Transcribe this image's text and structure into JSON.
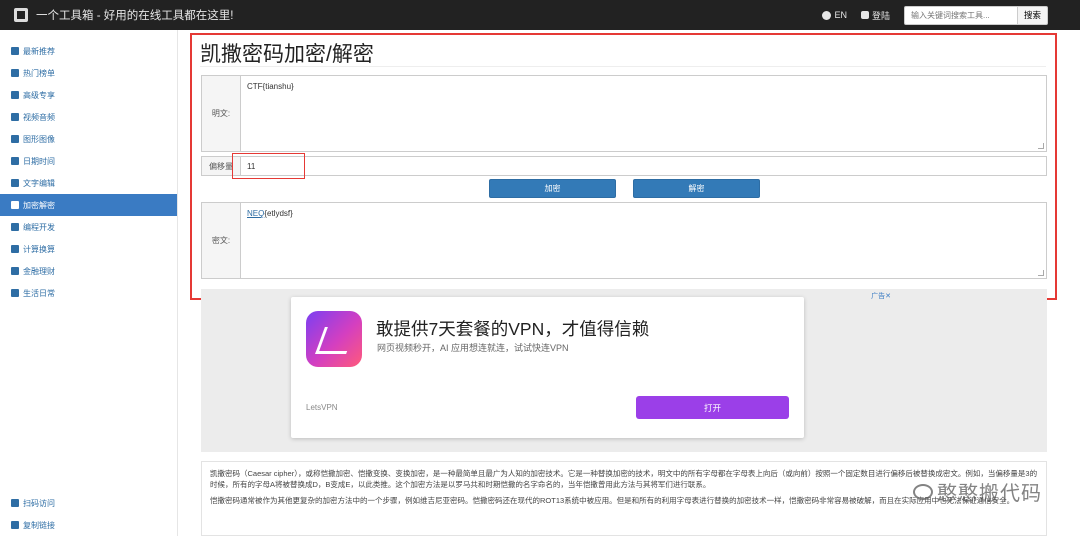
{
  "header": {
    "title": "一个工具箱 - 好用的在线工具都在这里!",
    "lang_label": "EN",
    "login_label": "登陆",
    "search_placeholder": "输入关键词搜索工具...",
    "search_button": "搜索"
  },
  "sidebar": {
    "items": [
      {
        "label": "最新推荐",
        "icon": "home-icon"
      },
      {
        "label": "热门榜单",
        "icon": "flag-icon"
      },
      {
        "label": "高级专享",
        "icon": "heart-icon"
      },
      {
        "label": "视频音频",
        "icon": "film-icon"
      },
      {
        "label": "图形图像",
        "icon": "image-icon"
      },
      {
        "label": "日期时间",
        "icon": "calendar-icon"
      },
      {
        "label": "文字编辑",
        "icon": "text-icon"
      },
      {
        "label": "加密解密",
        "icon": "lock-icon"
      },
      {
        "label": "编程开发",
        "icon": "code-icon"
      },
      {
        "label": "计算换算",
        "icon": "exchange-icon"
      },
      {
        "label": "金融理财",
        "icon": "money-icon"
      },
      {
        "label": "生活日常",
        "icon": "grid-icon"
      }
    ],
    "active_index": 7,
    "bottom": [
      {
        "label": "扫码访问",
        "icon": "qrcode-icon"
      },
      {
        "label": "复制链接",
        "icon": "link-icon"
      }
    ]
  },
  "tool": {
    "title": "凯撒密码加密/解密",
    "plaintext_label": "明文:",
    "plaintext_value": "CTF{tianshu}",
    "offset_label": "偏移量",
    "offset_value": "11",
    "encrypt_button": "加密",
    "decrypt_button": "解密",
    "ciphertext_label": "密文:",
    "ciphertext_value_underlined": "NEQ",
    "ciphertext_value_rest": "{etlydsf}"
  },
  "ad": {
    "marker": "广告✕",
    "headline": "敢提供7天套餐的VPN，才值得信赖",
    "subtext": "网页视频秒开，AI 应用想连就连，试试快连VPN",
    "brand": "LetsVPN",
    "button": "打开"
  },
  "description": {
    "p1": "凯撒密码（Caesar cipher），或称恺撒加密、恺撒变换、变换加密，是一种最简单且最广为人知的加密技术。它是一种替换加密的技术，明文中的所有字母都在字母表上向后（或向前）按照一个固定数目进行偏移后被替换成密文。例如，当偏移量是3的时候，所有的字母A将被替换成D，B变成E，以此类推。这个加密方法是以罗马共和时期恺撒的名字命名的，当年恺撒曾用此方法与其将军们进行联系。",
    "p2": "恺撒密码通常被作为其他更复杂的加密方法中的一个步骤，例如维吉尼亚密码。恺撒密码还在现代的ROT13系统中被应用。但是和所有的利用字母表进行替换的加密技术一样，恺撒密码非常容易被破解，而且在实际应用中也无法保证通信安全。"
  },
  "watermark": {
    "text": "憨憨搬代码"
  }
}
